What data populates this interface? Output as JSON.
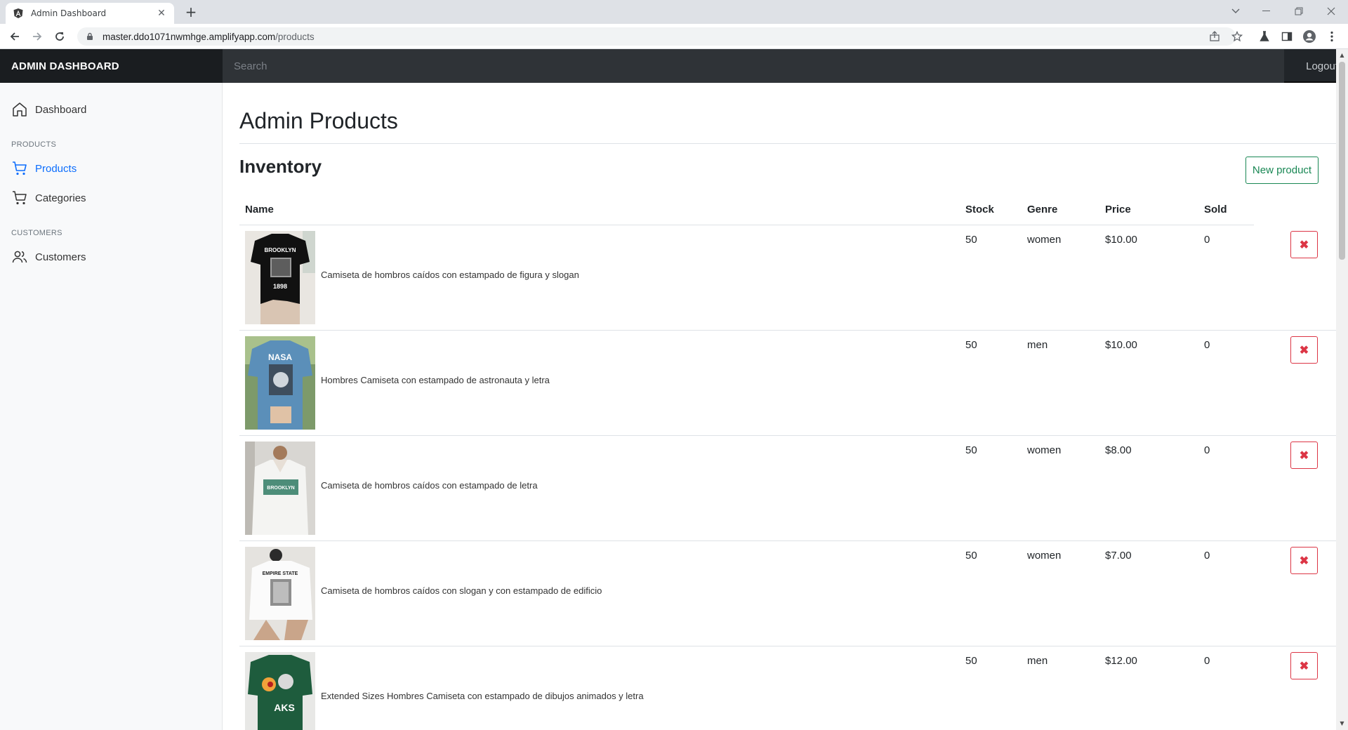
{
  "browser": {
    "tab_title": "Admin Dashboard",
    "url_host": "master.ddo1071nwmhge.amplifyapp.com",
    "url_path": "/products"
  },
  "header": {
    "brand": "ADMIN DASHBOARD",
    "search_placeholder": "Search",
    "logout": "Logout"
  },
  "sidebar": {
    "dashboard": "Dashboard",
    "products_heading": "PRODUCTS",
    "products": "Products",
    "categories": "Categories",
    "customers_heading": "CUSTOMERS",
    "customers": "Customers"
  },
  "main": {
    "title": "Admin Products",
    "section_title": "Inventory",
    "new_button": "New product",
    "columns": {
      "name": "Name",
      "stock": "Stock",
      "genre": "Genre",
      "price": "Price",
      "sold": "Sold"
    },
    "rows": [
      {
        "name": "Camiseta de hombros caídos con estampado de figura y slogan",
        "stock": "50",
        "genre": "women",
        "price": "$10.00",
        "sold": "0",
        "thumb_text": "BROOKLYN",
        "thumb_sub": "1898"
      },
      {
        "name": "Hombres Camiseta con estampado de astronauta y letra",
        "stock": "50",
        "genre": "men",
        "price": "$10.00",
        "sold": "0",
        "thumb_text": "NASA",
        "thumb_sub": ""
      },
      {
        "name": "Camiseta de hombros caídos con estampado de letra",
        "stock": "50",
        "genre": "women",
        "price": "$8.00",
        "sold": "0",
        "thumb_text": "BROOKLYN",
        "thumb_sub": ""
      },
      {
        "name": "Camiseta de hombros caídos con slogan y con estampado de edificio",
        "stock": "50",
        "genre": "women",
        "price": "$7.00",
        "sold": "0",
        "thumb_text": "EMPIRE STATE",
        "thumb_sub": ""
      },
      {
        "name": "Extended Sizes Hombres Camiseta con estampado de dibujos animados y letra",
        "stock": "50",
        "genre": "men",
        "price": "$12.00",
        "sold": "0",
        "thumb_text": "AKS",
        "thumb_sub": ""
      }
    ],
    "delete_glyph": "✖"
  }
}
